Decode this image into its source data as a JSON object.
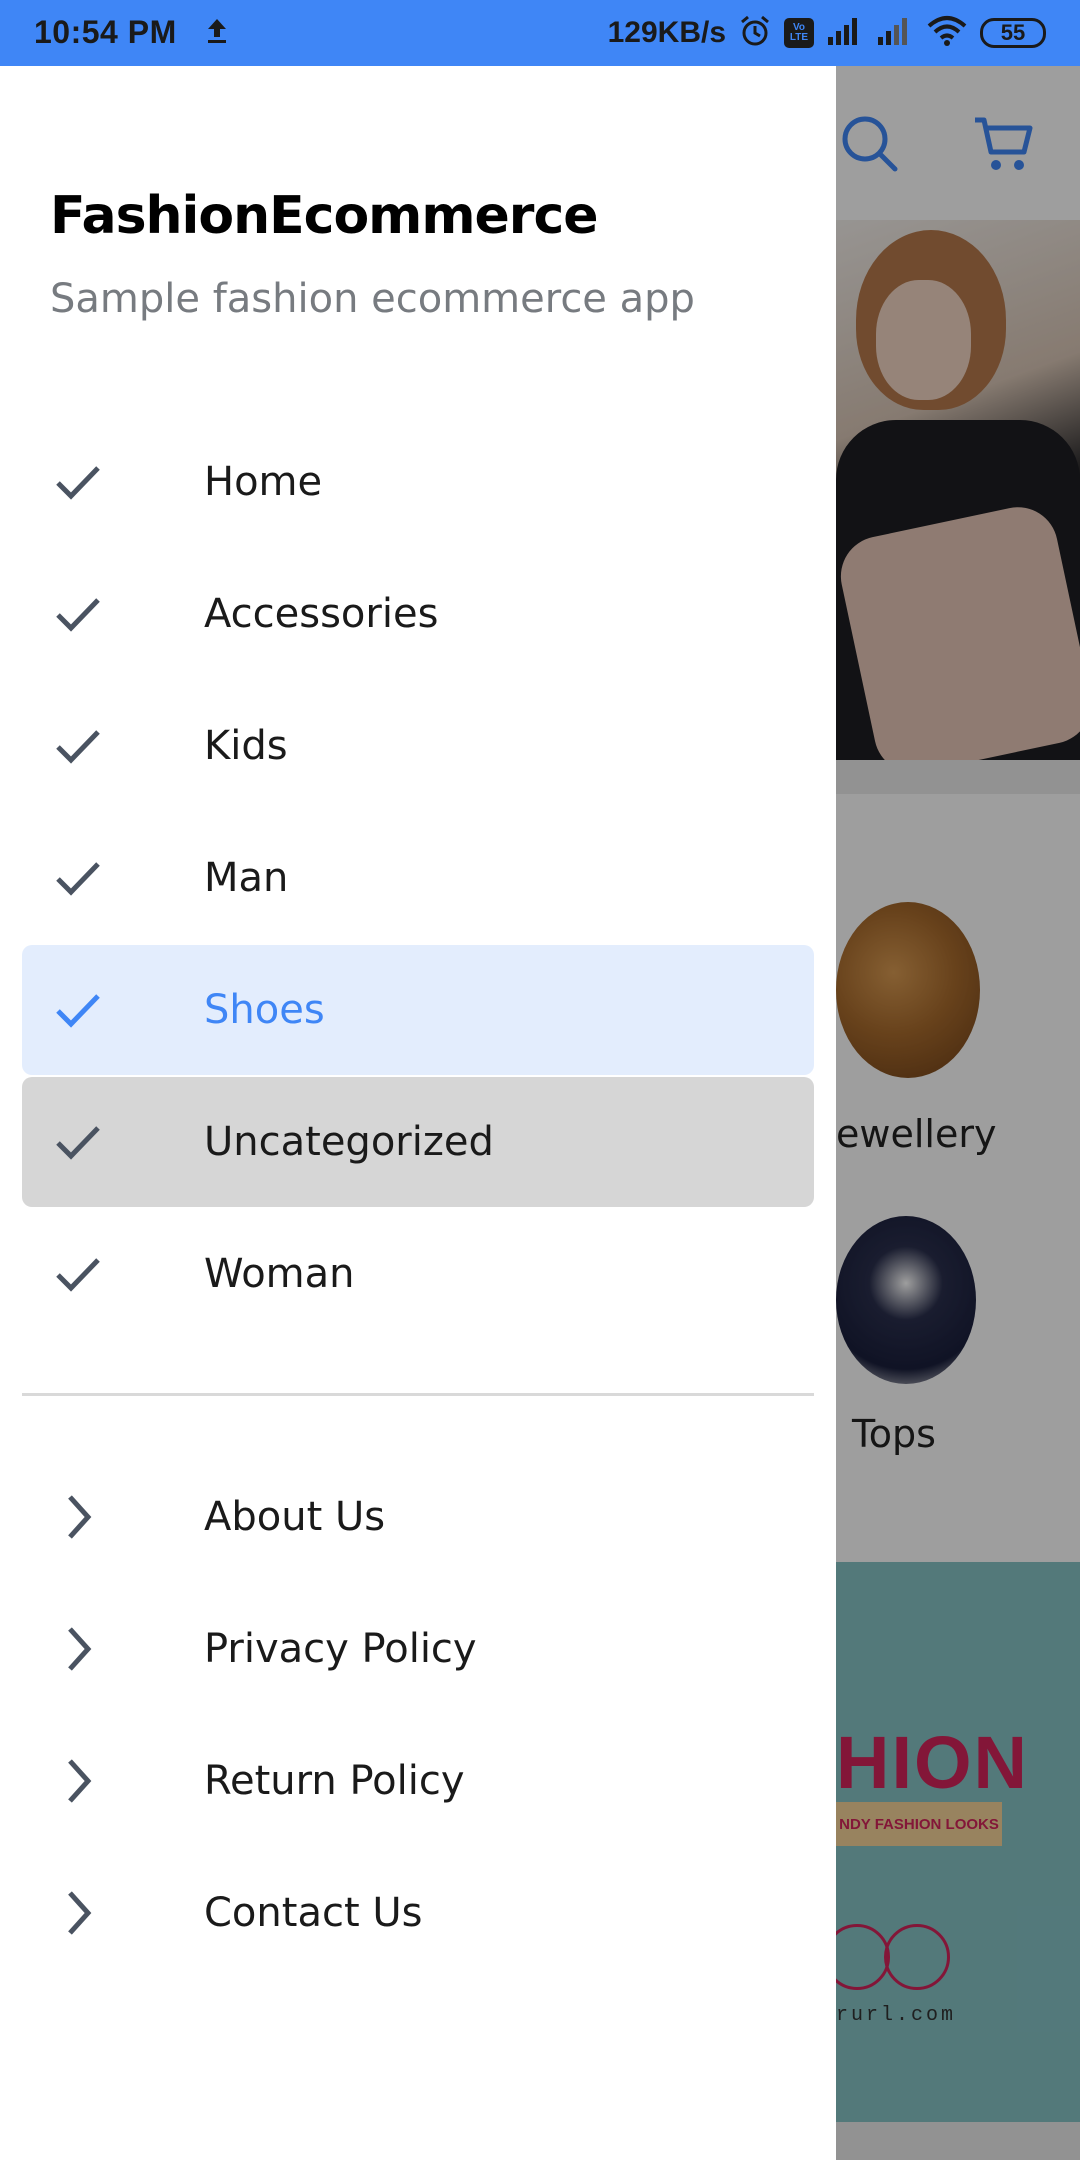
{
  "status_bar": {
    "time": "10:54 PM",
    "speed": "129KB/s",
    "battery": "55",
    "volte": "Vo LTE",
    "icons": [
      "upload-icon",
      "alarm-icon",
      "volte-icon",
      "signal-icon",
      "signal-icon",
      "wifi-icon",
      "battery-icon"
    ]
  },
  "drawer": {
    "title": "FashionEcommerce",
    "subtitle": "Sample fashion ecommerce app",
    "categories": [
      {
        "label": "Home",
        "state": "normal",
        "icon": "check-icon"
      },
      {
        "label": "Accessories",
        "state": "normal",
        "icon": "check-icon"
      },
      {
        "label": "Kids",
        "state": "normal",
        "icon": "check-icon"
      },
      {
        "label": "Man",
        "state": "normal",
        "icon": "check-icon"
      },
      {
        "label": "Shoes",
        "state": "selected",
        "icon": "check-icon"
      },
      {
        "label": "Uncategorized",
        "state": "pressed",
        "icon": "check-icon"
      },
      {
        "label": "Woman",
        "state": "normal",
        "icon": "check-icon"
      }
    ],
    "links": [
      {
        "label": "About Us",
        "icon": "chevron-right-icon"
      },
      {
        "label": "Privacy Policy",
        "icon": "chevron-right-icon"
      },
      {
        "label": "Return Policy",
        "icon": "chevron-right-icon"
      },
      {
        "label": "Contact Us",
        "icon": "chevron-right-icon"
      }
    ]
  },
  "background_app": {
    "toolbar_icons": [
      "search-icon",
      "cart-icon"
    ],
    "category_labels": [
      "ewellery",
      "Tops"
    ],
    "banner_text": "HION",
    "banner_strip": "NDY FASHION LOOKS",
    "banner_url": "rurl.com"
  },
  "colors": {
    "accent": "#3f86f6",
    "selected_bg": "#e3edfd",
    "pressed_bg": "#d6d6d6",
    "icon_gray": "#4a5361",
    "subtitle_gray": "#777b80"
  }
}
